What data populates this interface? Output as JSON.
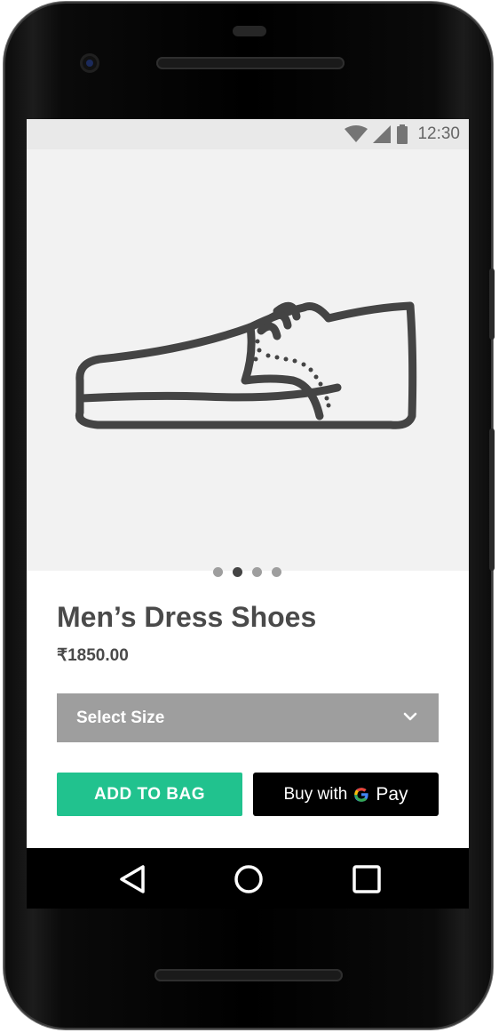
{
  "status_bar": {
    "time": "12:30",
    "icons": [
      "wifi-icon",
      "signal-icon",
      "battery-icon"
    ]
  },
  "product": {
    "image_icon": "shoe-illustration",
    "carousel": {
      "total": 4,
      "active_index": 1
    },
    "title": "Men’s Dress Shoes",
    "price": "₹1850.00"
  },
  "size_select": {
    "label": "Select Size",
    "icon": "chevron-down-icon"
  },
  "buttons": {
    "add_to_bag": "ADD TO BAG",
    "gpay_prefix": "Buy with",
    "gpay_suffix": "Pay"
  },
  "nav_bar": {
    "icons": [
      "back-icon",
      "home-icon",
      "recents-icon"
    ]
  },
  "colors": {
    "accent_green": "#21c28e",
    "select_gray": "#9e9e9e",
    "hero_bg": "#f2f2f2",
    "text_dark": "#4a4a4a"
  }
}
